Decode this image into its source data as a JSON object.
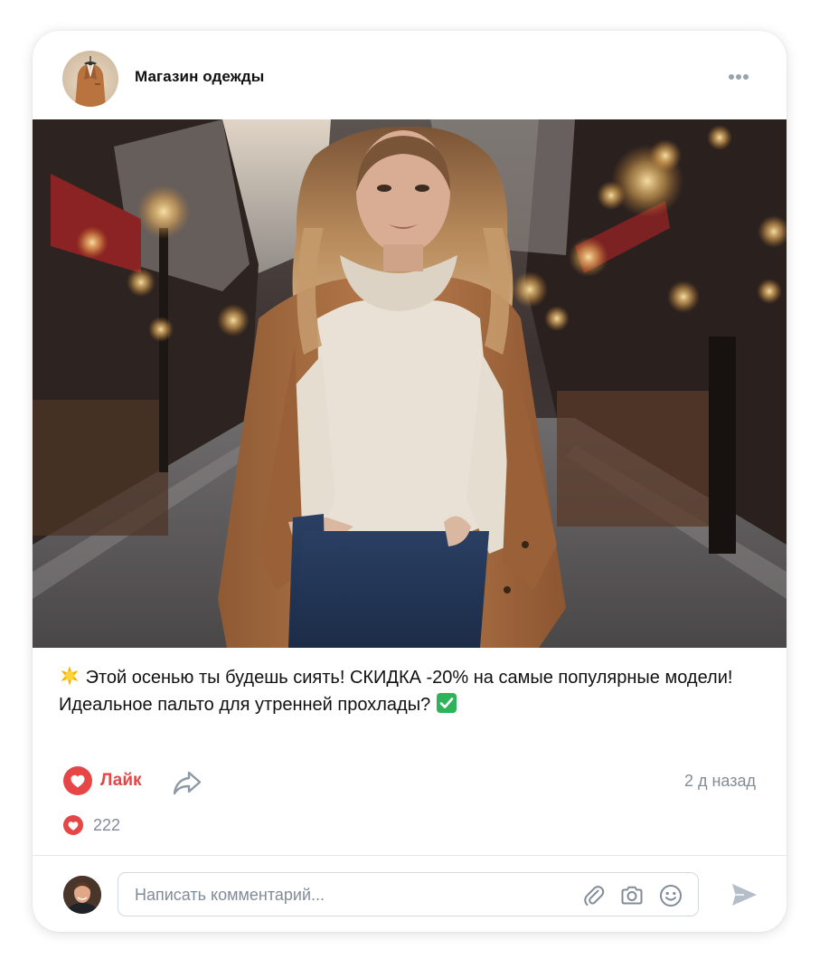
{
  "post": {
    "author": "Магазин одежды",
    "text_line1": "Этой осенью ты будешь сиять! СКИДКА -20% на самые популярные модели!",
    "text_line2": "Идеальное пальто для утренней прохлады?",
    "time": "2 д назад"
  },
  "actions": {
    "like_label": "Лайк",
    "likes_count": "222"
  },
  "comment": {
    "placeholder": "Написать комментарий..."
  },
  "icons": [
    "more-icon",
    "heart-icon",
    "share-icon",
    "paperclip-icon",
    "camera-icon",
    "smile-icon",
    "send-icon",
    "star-emoji",
    "check-emoji"
  ],
  "colors": {
    "accent_red": "#e64646",
    "secondary_text": "#818c99",
    "icon_gray": "#99a2ad",
    "check_green": "#2fb35a"
  }
}
